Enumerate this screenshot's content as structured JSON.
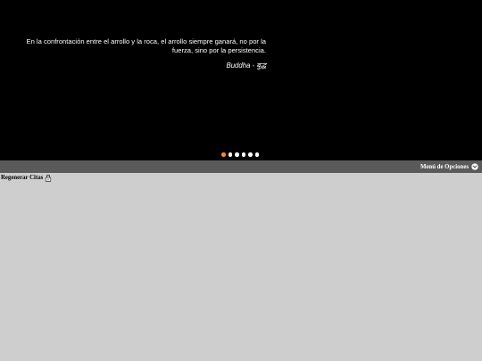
{
  "slider": {
    "quote": "En la confrontación entre el arrollo y la roca, el arrollo siempre ganará, no por la fuerza, sino por la persistencia.",
    "author": "Buddha - बुद्ध",
    "dots": [
      {
        "active": true
      },
      {
        "active": false
      },
      {
        "active": false
      },
      {
        "active": false
      },
      {
        "active": false
      },
      {
        "active": false
      }
    ],
    "active_dot_color": "#f08a3c",
    "dot_color": "#ffffff",
    "background": "#000000"
  },
  "options_bar": {
    "menu_label": "Menú de Opciones",
    "icon": "chevron-down-icon",
    "background": "#5a5a5a"
  },
  "content": {
    "regenerate_label": "Regenerar Citas",
    "regenerate_icon": "lock-icon",
    "background": "#cecece"
  }
}
